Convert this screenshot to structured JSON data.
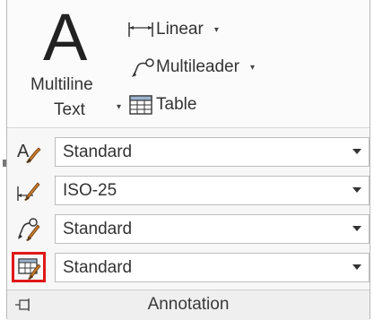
{
  "multiline_text": {
    "line1": "Multiline",
    "line2": "Text",
    "big_letter": "A",
    "arrow": "▾"
  },
  "tools": [
    {
      "label": "Linear",
      "icon": "linear-dimension-icon",
      "arrow": "▾"
    },
    {
      "label": "Multileader",
      "icon": "multileader-icon",
      "arrow": "▾"
    },
    {
      "label": "Table",
      "icon": "table-icon"
    }
  ],
  "styles": [
    {
      "icon": "text-style-icon",
      "value": "Standard"
    },
    {
      "icon": "dimension-style-icon",
      "value": "ISO-25"
    },
    {
      "icon": "multileader-style-icon",
      "value": "Standard"
    },
    {
      "icon": "table-style-icon",
      "value": "Standard",
      "highlighted": true
    }
  ],
  "footer": {
    "title": "Annotation",
    "icon": "pin-icon"
  },
  "colors": {
    "highlight": "#e01818",
    "brush_orange": "#c87a2a"
  }
}
